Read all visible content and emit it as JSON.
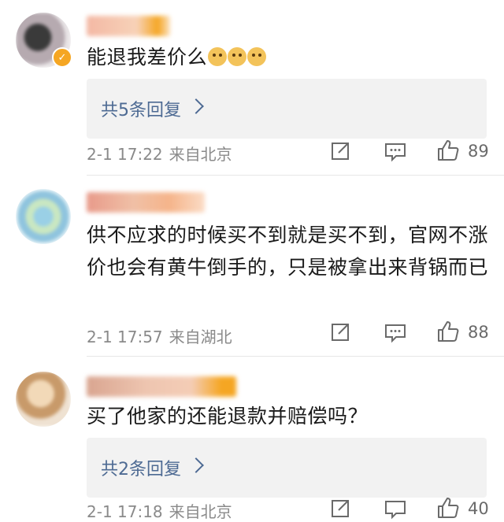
{
  "comments": [
    {
      "text": "能退我差价么",
      "emoji_icons": [
        "doge-icon",
        "doge-icon",
        "doge-icon"
      ],
      "replies_label": "共5条回复",
      "time": "2-1 17:22",
      "location": "来自北京",
      "likes": "89",
      "verified": true
    },
    {
      "text": "供不应求的时候买不到就是买不到，官网不涨价也会有黄牛倒手的，只是被拿出来背锅而已",
      "time": "2-1 17:57",
      "location": "来自湖北",
      "likes": "88",
      "verified": false
    },
    {
      "text": "买了他家的还能退款并赔偿吗？",
      "replies_label": "共2条回复",
      "time": "2-1 17:18",
      "location": "来自北京",
      "likes": "40",
      "verified": false
    }
  ],
  "colors": {
    "link": "#4d6a93",
    "meta": "#8a8a8a",
    "verified_badge": "#f5a623"
  }
}
